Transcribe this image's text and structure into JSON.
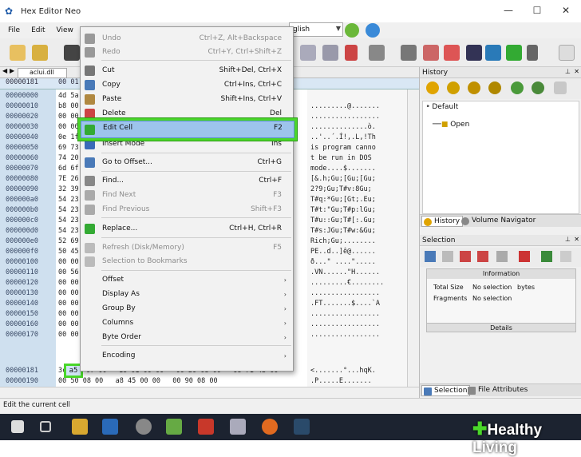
{
  "window": {
    "title": "Hex Editor Neo",
    "min": "—",
    "max": "☐",
    "close": "✕"
  },
  "menubar": {
    "file": "File",
    "edit": "Edit",
    "view": "View"
  },
  "toolbar": {
    "language_combo": "glish"
  },
  "doc_tab": {
    "label": "aclui.dll"
  },
  "hex_rows": [
    {
      "off": "00000181",
      "hex": "00 01",
      "asc": ""
    },
    {
      "off": "00000000",
      "hex": "4d 5a",
      "asc": ""
    },
    {
      "off": "00000010",
      "hex": "b8 00",
      "asc": ".........@......."
    },
    {
      "off": "00000020",
      "hex": "00 00",
      "asc": "................."
    },
    {
      "off": "00000030",
      "hex": "00 00",
      "asc": "..............ò."
    },
    {
      "off": "00000040",
      "hex": "0e 1f",
      "asc": "..'..´.Í!,.L,!Th"
    },
    {
      "off": "00000050",
      "hex": "69 73",
      "asc": "is program canno"
    },
    {
      "off": "00000060",
      "hex": "74 20",
      "asc": "t be run in DOS "
    },
    {
      "off": "00000070",
      "hex": "6d 6f",
      "asc": "mode....$......."
    },
    {
      "off": "00000080",
      "hex": "7E 26",
      "asc": "[&.h;Gu;[Gu;[Gu;"
    },
    {
      "off": "00000090",
      "hex": "32 39",
      "asc": "2?9;Gu;T#v:8Gu;"
    },
    {
      "off": "000000a0",
      "hex": "54 23",
      "asc": "T#q:*Gu;[Gt;.Eu;"
    },
    {
      "off": "000000b0",
      "hex": "54 23",
      "asc": "T#t:\"Gu;T#p:lGu;"
    },
    {
      "off": "000000c0",
      "hex": "54 23",
      "asc": "T#u::Gu;T#[:.Gu;"
    },
    {
      "off": "000000d0",
      "hex": "54 23",
      "asc": "T#s:JGu;T#w:&Gu;"
    },
    {
      "off": "000000e0",
      "hex": "52 69",
      "asc": "Rich;Gu;........"
    },
    {
      "off": "000000f0",
      "hex": "50 45",
      "asc": "PE..d..]ê@......"
    },
    {
      "off": "00000100",
      "hex": "00 00",
      "asc": "ð...\" ....\"....."
    },
    {
      "off": "00000110",
      "hex": "00 56",
      "asc": ".VN......\"H......"
    },
    {
      "off": "00000120",
      "hex": "00 00",
      "asc": ".........€........"
    },
    {
      "off": "00000130",
      "hex": "00 00",
      "asc": "................."
    },
    {
      "off": "00000140",
      "hex": "00 00",
      "asc": ".FT.......$....`A"
    },
    {
      "off": "00000150",
      "hex": "00 00",
      "asc": "................."
    },
    {
      "off": "00000160",
      "hex": "00 00",
      "asc": "................."
    },
    {
      "off": "00000170",
      "hex": "00 00",
      "asc": "................."
    }
  ],
  "hex_cursor_row": {
    "off": "00000181",
    "hex": "3c",
    "hex2": "07 00   18 01 00 00   00 b0 08 00   68 71 4b 00",
    "asc": "<.......°...hqK."
  },
  "hex_last_row": {
    "off": "00000190",
    "hex": "00 50 08 00   a8 45 00 00   00 90 08 00",
    "asc": ".P.....E......."
  },
  "selected_cell": "a5",
  "context_menu": {
    "undo": {
      "label": "Undo",
      "shortcut": "Ctrl+Z, Alt+Backspace"
    },
    "redo": {
      "label": "Redo",
      "shortcut": "Ctrl+Y, Ctrl+Shift+Z"
    },
    "cut": {
      "label": "Cut",
      "shortcut": "Shift+Del, Ctrl+X"
    },
    "copy": {
      "label": "Copy",
      "shortcut": "Ctrl+Ins, Ctrl+C"
    },
    "paste": {
      "label": "Paste",
      "shortcut": "Shift+Ins, Ctrl+V"
    },
    "delete": {
      "label": "Delete",
      "shortcut": "Del"
    },
    "edit_cell": {
      "label": "Edit Cell",
      "shortcut": "F2"
    },
    "insert_mode": {
      "label": "Insert Mode",
      "shortcut": "Ins"
    },
    "goto_offset": {
      "label": "Go to Offset...",
      "shortcut": "Ctrl+G"
    },
    "find": {
      "label": "Find...",
      "shortcut": "Ctrl+F"
    },
    "find_next": {
      "label": "Find Next",
      "shortcut": "F3"
    },
    "find_previous": {
      "label": "Find Previous",
      "shortcut": "Shift+F3"
    },
    "replace": {
      "label": "Replace...",
      "shortcut": "Ctrl+H, Ctrl+R"
    },
    "refresh": {
      "label": "Refresh (Disk/Memory)",
      "shortcut": "F5"
    },
    "selection_bookmarks": {
      "label": "Selection to Bookmarks",
      "shortcut": ""
    },
    "offset": {
      "label": "Offset"
    },
    "display_as": {
      "label": "Display As"
    },
    "group_by": {
      "label": "Group By"
    },
    "columns": {
      "label": "Columns"
    },
    "byte_order": {
      "label": "Byte Order"
    },
    "encoding": {
      "label": "Encoding"
    }
  },
  "history_panel": {
    "title": "History",
    "root": "Default",
    "child": "Open"
  },
  "right_tabs": {
    "history": "History",
    "volume_nav": "Volume Navigator"
  },
  "selection_panel": {
    "title": "Selection",
    "info_header": "Information",
    "total_size_label": "Total Size",
    "total_size_value": "No selection",
    "total_size_unit": "bytes",
    "fragments_label": "Fragments",
    "fragments_value": "No selection",
    "details": "Details"
  },
  "bottom_tabs": {
    "selection": "Selection",
    "file_attributes": "File Attributes"
  },
  "statusbar": {
    "text": "Edit the current cell"
  },
  "watermark": {
    "text": "Healthy Living"
  },
  "colors": {
    "highlight_border": "#4ad62a",
    "menu_selected": "#9dc4ec",
    "taskbar": "#1c2330"
  }
}
